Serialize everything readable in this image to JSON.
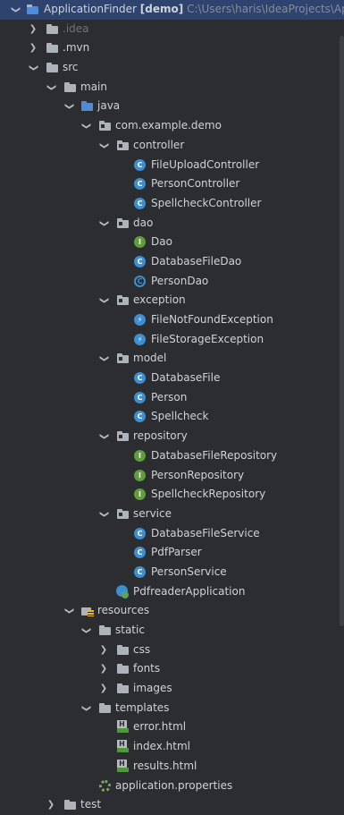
{
  "project": {
    "name": "ApplicationFinder",
    "module": "[demo]",
    "path": "C:\\Users\\haris\\IdeaProjects\\Ap"
  },
  "tree": {
    "idea": ".idea",
    "mvn": ".mvn",
    "src": "src",
    "main": "main",
    "java": "java",
    "package": "com.example.demo",
    "controller": "controller",
    "FileUploadController": "FileUploadController",
    "PersonController": "PersonController",
    "SpellcheckController": "SpellcheckController",
    "dao": "dao",
    "Dao": "Dao",
    "DatabaseFileDao": "DatabaseFileDao",
    "PersonDao": "PersonDao",
    "exception": "exception",
    "FileNotFoundException": "FileNotFoundException",
    "FileStorageException": "FileStorageException",
    "model": "model",
    "DatabaseFile": "DatabaseFile",
    "Person": "Person",
    "Spellcheck": "Spellcheck",
    "repository": "repository",
    "DatabaseFileRepository": "DatabaseFileRepository",
    "PersonRepository": "PersonRepository",
    "SpellcheckRepository": "SpellcheckRepository",
    "service": "service",
    "DatabaseFileService": "DatabaseFileService",
    "PdfParser": "PdfParser",
    "PersonService": "PersonService",
    "PdfreaderApplication": "PdfreaderApplication",
    "resources": "resources",
    "static": "static",
    "css": "css",
    "fonts": "fonts",
    "images": "images",
    "templates": "templates",
    "error": "error.html",
    "index": "index.html",
    "results": "results.html",
    "appprops": "application.properties",
    "test": "test"
  },
  "colors": {
    "background": "#2b2d30",
    "selected": "#2e436e",
    "class": "#3d8fd1",
    "interface": "#5f9e3a"
  }
}
